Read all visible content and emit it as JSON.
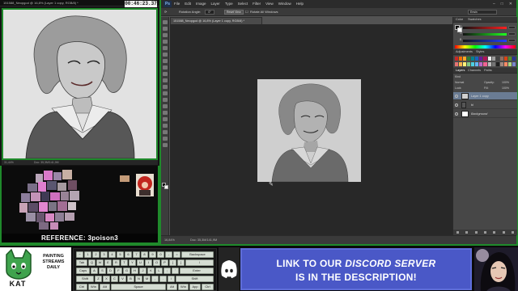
{
  "stream": {
    "clock": "00:46:23.37",
    "reference_label": "REFERENCE: 3poison3",
    "left_window": {
      "title": "151588_Neopgod @ 16,8% (Layer 1 copy, RGB/8) *",
      "zoom": "31,44%",
      "doc_size": "Doc: 35,3M/141,9M"
    }
  },
  "photoshop": {
    "logo": "Ps",
    "menu": [
      "File",
      "Edit",
      "Image",
      "Layer",
      "Type",
      "Select",
      "Filter",
      "View",
      "Window",
      "Help"
    ],
    "options": {
      "rotation_label": "Rotation Angle:",
      "rotation_value": "0°",
      "reset_button": "Reset View",
      "rotate_all_label": "Rotate All Windows",
      "workspace": "Erwin"
    },
    "doc_tab": "151588_Neopgod @ 16,8% (Layer 1 copy, RGB/8) *",
    "status": {
      "zoom": "16,84%",
      "doc_size": "Doc: 35,3M/141,9M"
    },
    "panels": {
      "color_tabs": [
        "Color",
        "Swatches"
      ],
      "channels": [
        "R",
        "G",
        "B"
      ],
      "adjust_tabs": [
        "Adjustments",
        "Styles"
      ],
      "layers_tabs": [
        "Layers",
        "Channels",
        "Paths"
      ],
      "kind": "Kind",
      "blend_mode": "Normal",
      "opacity_label": "Opacity:",
      "opacity_value": "100%",
      "lock_label": "Lock:",
      "fill_label": "Fill:",
      "fill_value": "100%",
      "layers": [
        {
          "name": "Layer 1 copy"
        },
        {
          "name": "bl"
        },
        {
          "name": "Background"
        }
      ]
    }
  },
  "keyboard": {
    "rows": [
      [
        "~",
        "1",
        "2",
        "3",
        "4",
        "5",
        "6",
        "7",
        "8",
        "9",
        "0",
        "-",
        "=",
        "Backspace"
      ],
      [
        "Tab",
        "Q",
        "W",
        "E",
        "R",
        "T",
        "Y",
        "U",
        "I",
        "O",
        "P",
        "[",
        "]",
        "\\"
      ],
      [
        "Caps",
        "A",
        "S",
        "D",
        "F",
        "G",
        "H",
        "J",
        "K",
        "L",
        ";",
        "'",
        "Enter"
      ],
      [
        "Shift",
        "Z",
        "X",
        "C",
        "V",
        "B",
        "N",
        "M",
        ",",
        ".",
        "/",
        "Shift"
      ],
      [
        "Ctrl",
        "Win",
        "Alt",
        "Space",
        "Alt",
        "Win",
        "App",
        "Ctrl"
      ]
    ]
  },
  "branding": {
    "kat": "KAT",
    "tagline_1": "PAINTING",
    "tagline_2": "STREAMS",
    "tagline_3": "DAILY"
  },
  "discord": {
    "line1_a": "LINK TO OUR",
    "line1_b": "DISCORD SERVER",
    "line2": "IS IN THE DESCRIPTION!"
  },
  "colors": {
    "frame_green": "#1f8a2b",
    "discord_blue": "#4a58c7",
    "ps_dark": "#282828"
  }
}
